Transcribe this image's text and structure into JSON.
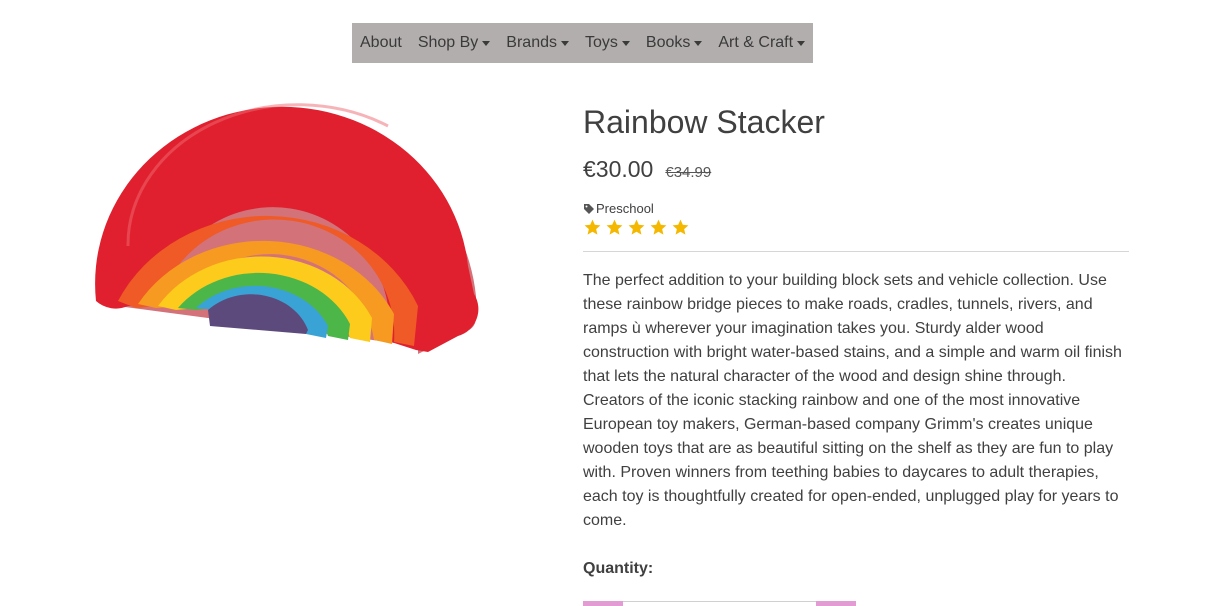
{
  "nav": {
    "items": [
      {
        "label": "About",
        "dropdown": false
      },
      {
        "label": "Shop By",
        "dropdown": true
      },
      {
        "label": "Brands",
        "dropdown": true
      },
      {
        "label": "Toys",
        "dropdown": true
      },
      {
        "label": "Books",
        "dropdown": true
      },
      {
        "label": "Art & Craft",
        "dropdown": true
      }
    ]
  },
  "product": {
    "title": "Rainbow Stacker",
    "price": "€30.00",
    "old_price": "€34.99",
    "tag_icon": "tag-icon",
    "tag": "Preschool",
    "rating": 5,
    "rating_max": 5,
    "star_color": "#f5b800",
    "description": "The perfect addition to your building block sets and vehicle collection. Use these rainbow bridge pieces to make roads, cradles, tunnels, rivers, and ramps ù wherever your imagination takes you. Sturdy alder wood construction with bright water-based stains, and a simple and warm oil finish that lets the natural character of the wood and design shine through. Creators of the iconic stacking rainbow and one of the most innovative European toy makers, German-based company Grimm's creates unique wooden toys that are as beautiful sitting on the shelf as they are fun to play with. Proven winners from teething babies to daycares to adult therapies, each toy is thoughtfully created for open-ended, unplugged play for years to come.",
    "quantity_label": "Quantity:"
  },
  "colors": {
    "nav_bg": "#b3aeae",
    "qty_button": "#e29bd3",
    "rainbow": [
      "#e0202e",
      "#ef5a26",
      "#f79a22",
      "#fccb1c",
      "#4cb648",
      "#3aa3d6",
      "#5d4a7c"
    ]
  }
}
